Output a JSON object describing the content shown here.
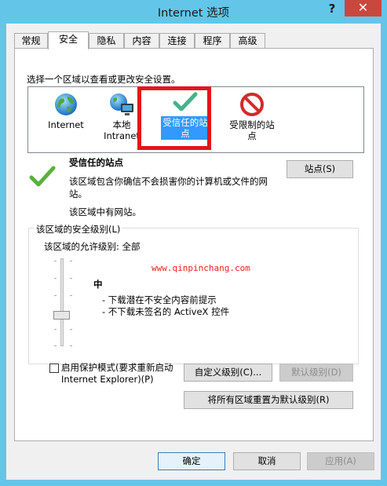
{
  "window": {
    "title": "Internet 选项",
    "help": "?",
    "close": "✕"
  },
  "tabs": [
    {
      "label": "常规",
      "active": false
    },
    {
      "label": "安全",
      "active": true
    },
    {
      "label": "隐私",
      "active": false
    },
    {
      "label": "内容",
      "active": false
    },
    {
      "label": "连接",
      "active": false
    },
    {
      "label": "程序",
      "active": false
    },
    {
      "label": "高级",
      "active": false
    }
  ],
  "security": {
    "zone_prompt": "选择一个区域以查看或更改安全设置。",
    "zones": [
      {
        "label": "Internet",
        "icon": "globe-icon"
      },
      {
        "label": "本地\nIntranet",
        "icon": "local-intranet-icon"
      },
      {
        "label": "受信任的站\n点",
        "icon": "check-icon",
        "selected": true
      },
      {
        "label": "受限制的站\n点",
        "icon": "no-entry-icon"
      }
    ],
    "selected_zone_title": "受信任的站点",
    "selected_zone_desc": "该区域包含你确信不会损害你的计算机或文件的网站。",
    "selected_zone_has": "该区域中有网站。",
    "sites_button": "站点(S)",
    "level_group_label": "该区域的安全级别(L)",
    "allowed_levels": "该区域的允许级别: 全部",
    "level_name": "中",
    "level_points": [
      "- 下载潜在不安全内容前提示",
      "- 不下载未签名的 ActiveX 控件"
    ],
    "protected_mode_label": "启用保护模式(要求重新启动 Internet Explorer)(P)",
    "protected_mode_checked": false,
    "custom_level_button": "自定义级别(C)...",
    "default_level_button": "默认级别(D)",
    "reset_all_button": "将所有区域重置为默认级别(R)",
    "watermark": "www.qinpinchang.com"
  },
  "footer": {
    "ok": "确定",
    "cancel": "取消",
    "apply": "应用(A)"
  },
  "colors": {
    "titlebar": "#63c6e8",
    "close": "#c9483d",
    "selection": "#3399ff",
    "highlight_box": "#e2151c",
    "watermark": "#ff1a1a"
  }
}
